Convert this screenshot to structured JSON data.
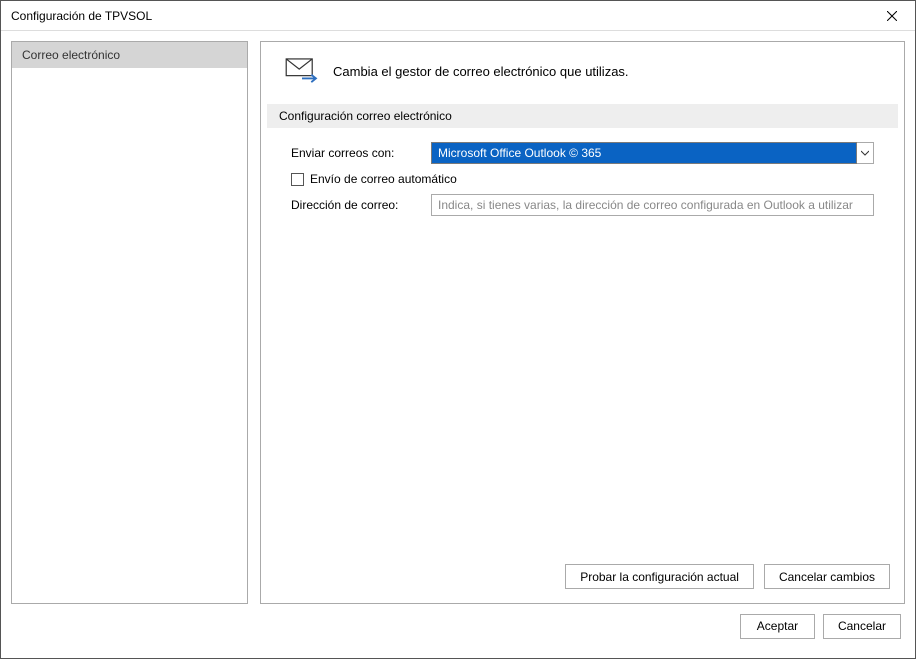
{
  "window": {
    "title": "Configuración de TPVSOL"
  },
  "sidebar": {
    "items": [
      {
        "label": "Correo electrónico"
      }
    ]
  },
  "header": {
    "text": "Cambia el gestor de correo electrónico que utilizas."
  },
  "section": {
    "title": "Configuración correo electrónico"
  },
  "form": {
    "send_with_label": "Enviar correos con:",
    "send_with_value": "Microsoft Office Outlook © 365",
    "auto_send_label": "Envío de correo automático",
    "address_label": "Dirección de correo:",
    "address_placeholder": "Indica, si tienes varias, la dirección de correo configurada en Outlook a utilizar"
  },
  "panel_buttons": {
    "test": "Probar la configuración actual",
    "cancel_changes": "Cancelar cambios"
  },
  "dialog_buttons": {
    "accept": "Aceptar",
    "cancel": "Cancelar"
  }
}
